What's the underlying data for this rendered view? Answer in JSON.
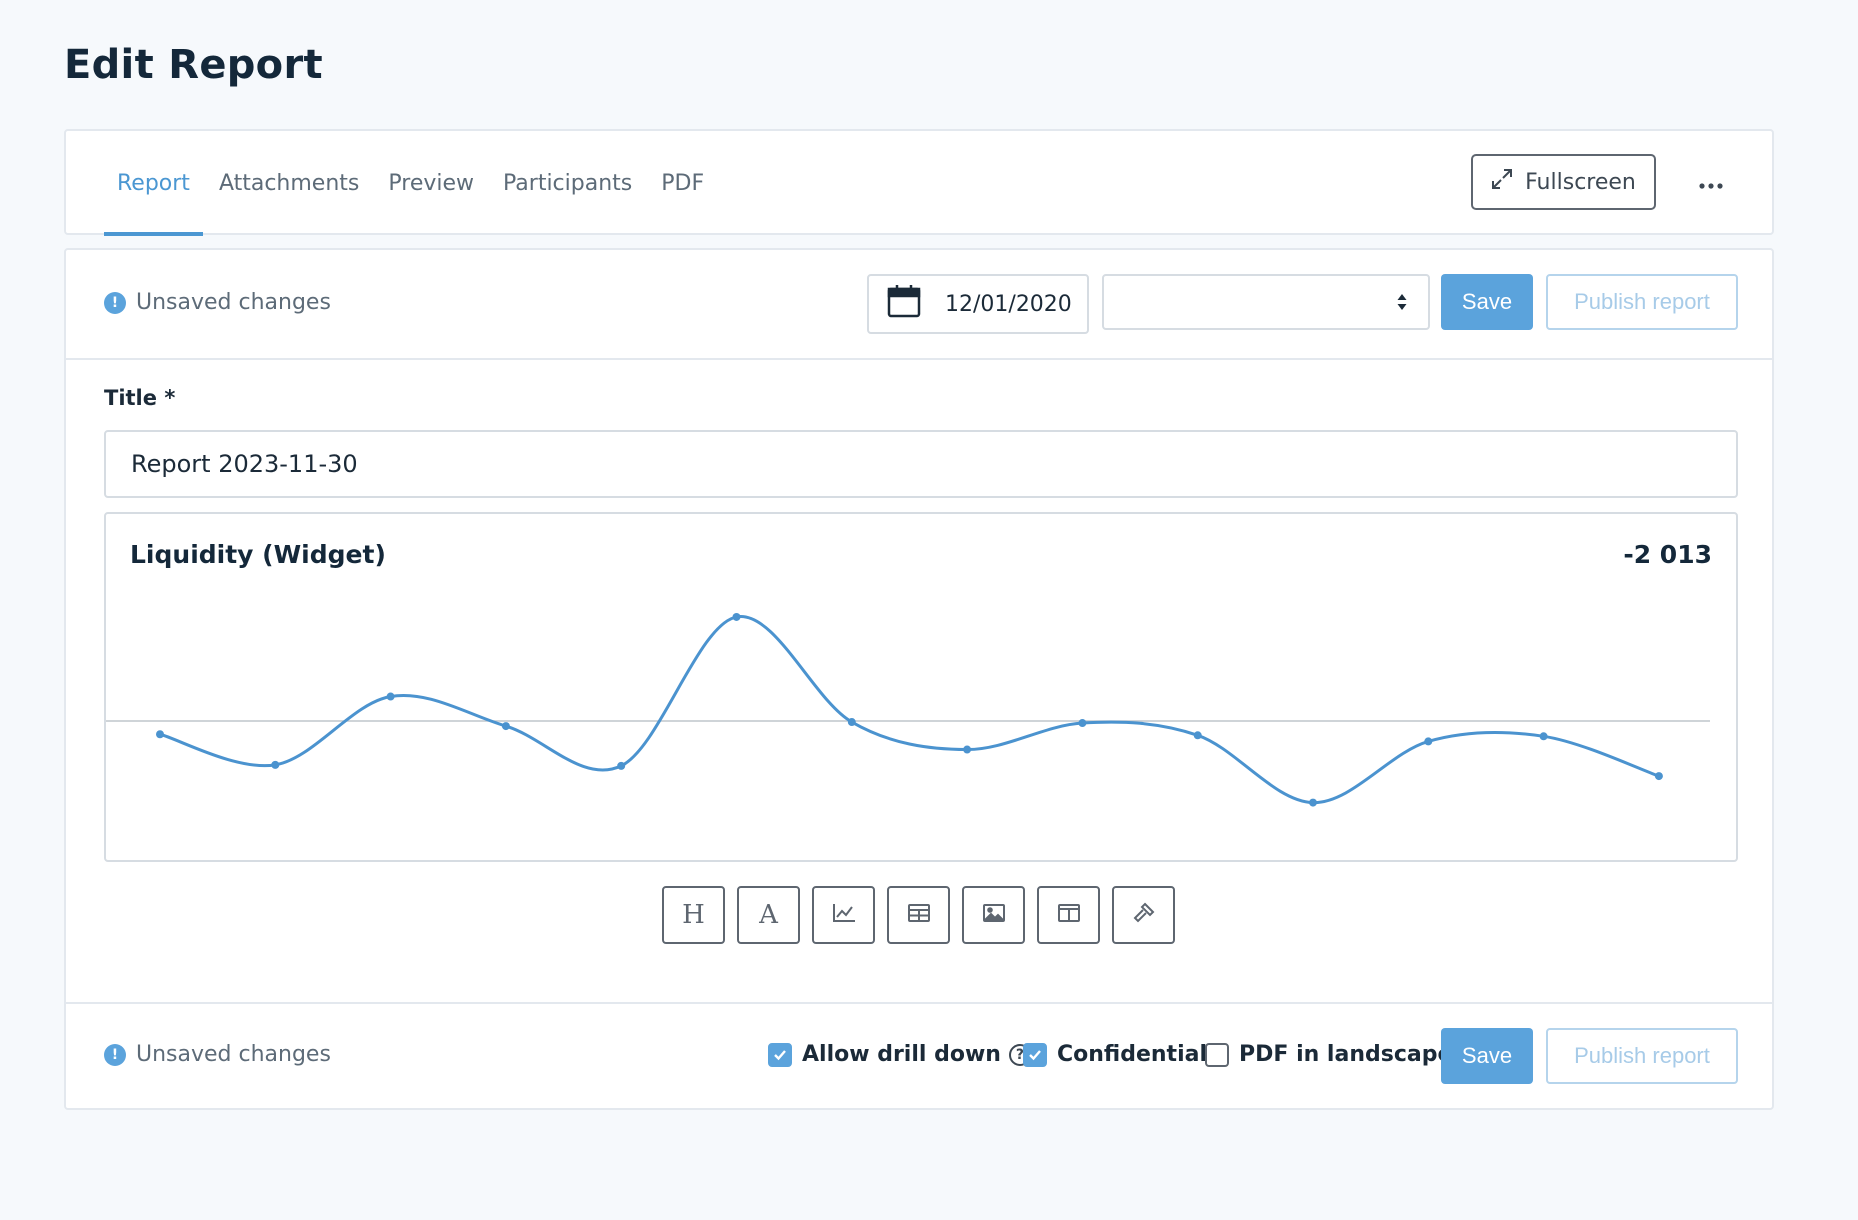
{
  "page": {
    "title": "Edit Report"
  },
  "tabs": [
    {
      "label": "Report",
      "active": true
    },
    {
      "label": "Attachments",
      "active": false
    },
    {
      "label": "Preview",
      "active": false
    },
    {
      "label": "Participants",
      "active": false
    },
    {
      "label": "PDF",
      "active": false
    }
  ],
  "header_actions": {
    "fullscreen_label": "Fullscreen",
    "more_icon": "ellipsis-icon"
  },
  "toolbar": {
    "status": "Unsaved changes",
    "date": "12/01/2020",
    "select_value": "",
    "save_label": "Save",
    "publish_label": "Publish report"
  },
  "form": {
    "title_label": "Title *",
    "title_value": "Report 2023-11-30"
  },
  "widget": {
    "title": "Liquidity (Widget)",
    "value": "-2 013"
  },
  "chart_data": {
    "type": "line",
    "title": "Liquidity (Widget)",
    "series": [
      {
        "values": [
          -13,
          -43,
          24,
          -5,
          -44,
          102,
          -1,
          -28,
          -2,
          -14,
          -80,
          -20,
          -15,
          -54
        ]
      }
    ],
    "ylim": [
      -120,
      120
    ],
    "baseline": 0,
    "grid": false,
    "color": "#4b93cf"
  },
  "insert_toolbar": [
    {
      "name": "heading",
      "icon": "heading-icon"
    },
    {
      "name": "text",
      "icon": "text-icon"
    },
    {
      "name": "chart",
      "icon": "chart-icon"
    },
    {
      "name": "table",
      "icon": "table-icon"
    },
    {
      "name": "image",
      "icon": "image-icon"
    },
    {
      "name": "columns",
      "icon": "columns-icon"
    },
    {
      "name": "widget",
      "icon": "hammer-icon"
    }
  ],
  "footer": {
    "status": "Unsaved changes",
    "allow_drill_down_label": "Allow drill down",
    "allow_drill_down": true,
    "confidential_label": "Confidential",
    "confidential": true,
    "pdf_landscape_label": "PDF in landscape",
    "pdf_landscape": false,
    "save_label": "Save",
    "publish_label": "Publish report"
  },
  "colors": {
    "accent": "#4b97d2",
    "primary_button": "#5ba3dc",
    "publish_text": "#a7cbe8",
    "background": "#f6f9fc"
  }
}
